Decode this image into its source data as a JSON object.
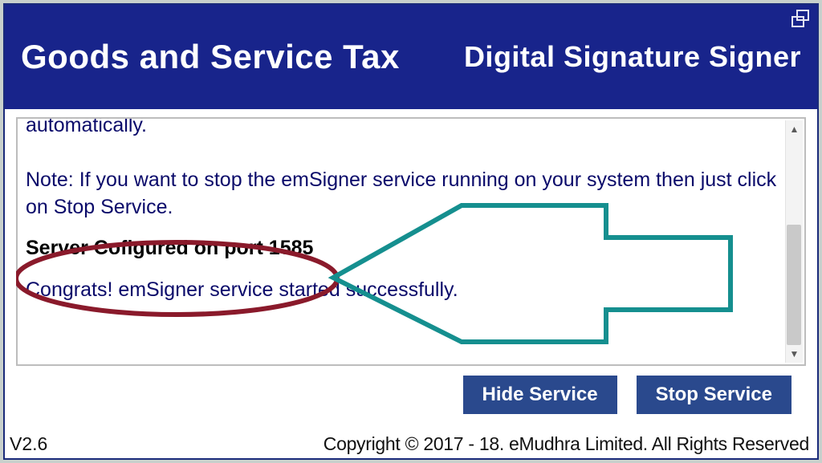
{
  "header": {
    "title_left": "Goods and Service Tax",
    "title_right": "Digital Signature Signer"
  },
  "log": {
    "line_partial_top": "automatically.",
    "note_line": "Note: If you want to stop the emSigner service running on your system then just click on Stop Service.",
    "bold_status": "Server Cofigured on port 1585",
    "success_line": "Congrats! emSigner service started successfully."
  },
  "buttons": {
    "hide": "Hide Service",
    "stop": "Stop Service"
  },
  "footer": {
    "version": "V2.6",
    "copyright": "Copyright © 2017 - 18. eMudhra Limited. All Rights Reserved"
  }
}
